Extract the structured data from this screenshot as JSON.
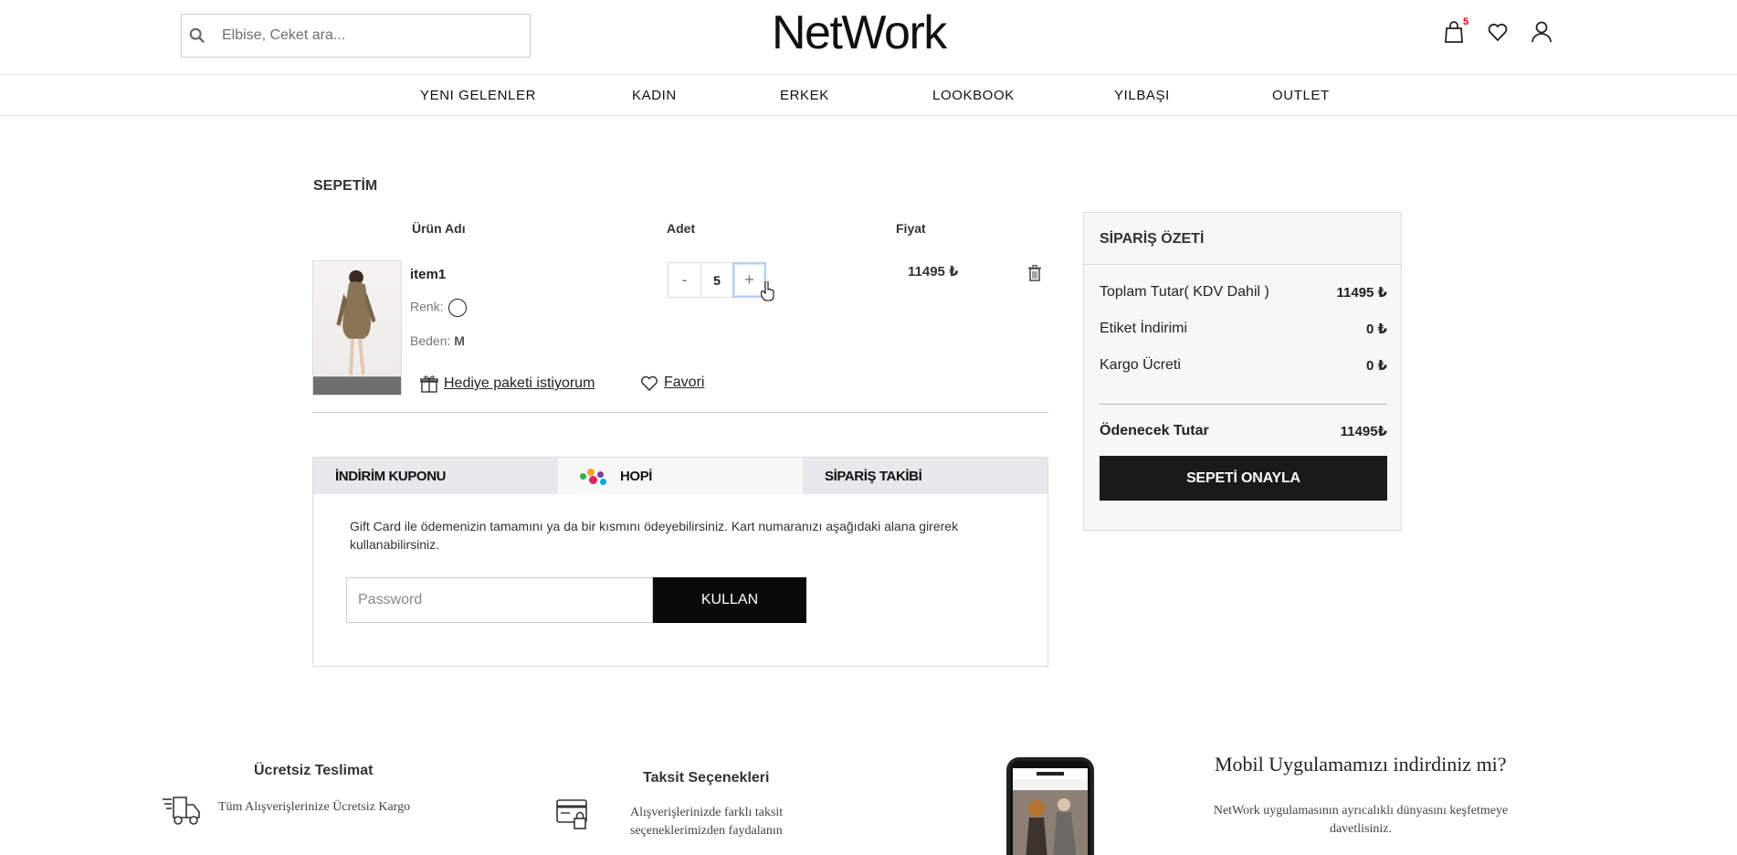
{
  "header": {
    "search_placeholder": "Elbise, Ceket ara...",
    "logo": "NetWork",
    "cart_count": "5"
  },
  "nav": {
    "items": [
      "YENI GELENLER",
      "KADIN",
      "ERKEK",
      "LOOKBOOK",
      "YILBAŞI",
      "OUTLET"
    ]
  },
  "cart": {
    "title": "SEPETİM",
    "columns": {
      "product": "Ürün Adı",
      "qty": "Adet",
      "price": "Fiyat"
    },
    "item": {
      "name": "item1",
      "color_label": "Renk:",
      "size_label": "Beden:",
      "size_value": "M",
      "qty_minus": "-",
      "qty": "5",
      "qty_plus": "+",
      "price": "11495 ₺",
      "gift_label": "Hediye paketi istiyorum",
      "fav_label": "Favori"
    }
  },
  "tabs": {
    "items": [
      "İNDİRİM KUPONU",
      "HOPİ",
      "SİPARİŞ TAKİBİ"
    ],
    "description": "Gift Card ile ödemenizin tamamını ya da bir kısmını ödeyebilirsiniz. Kart numaranızı aşağıdaki alana girerek kullanabilirsiniz.",
    "password_placeholder": "Password",
    "use_button": "KULLAN"
  },
  "summary": {
    "title": "SİPARİŞ ÖZETİ",
    "rows": [
      {
        "label": "Toplam Tutar( KDV Dahil )",
        "value": "11495 ₺"
      },
      {
        "label": "Etiket İndirimi",
        "value": "0 ₺"
      },
      {
        "label": "Kargo Ücreti",
        "value": "0 ₺"
      }
    ],
    "total_label": "Ödenecek Tutar",
    "total_value": "11495₺",
    "confirm_button": "SEPETİ ONAYLA"
  },
  "footer": {
    "shipping_title": "Ücretsiz Teslimat",
    "shipping_text": "Tüm Alışverişlerinize Ücretsiz Kargo",
    "installment_title": "Taksit Seçenekleri",
    "installment_text": "Alışverişlerinizde farklı taksit seçeneklerimizden faydalanın",
    "app_title": "Mobil Uygulamamızı indirdiniz mi?",
    "app_text": "NetWork uygulamasının ayrıcalıklı dünyasını keşfetmeye davetlisiniz."
  },
  "colors": {
    "accent": "#1a1a1a",
    "cart_badge": "#ee0000",
    "tab_bg": "#e8e8ec"
  },
  "icons": [
    "search-icon",
    "bag-icon",
    "heart-icon",
    "user-icon",
    "trash-icon",
    "gift-icon",
    "truck-icon",
    "credit-card-icon"
  ]
}
